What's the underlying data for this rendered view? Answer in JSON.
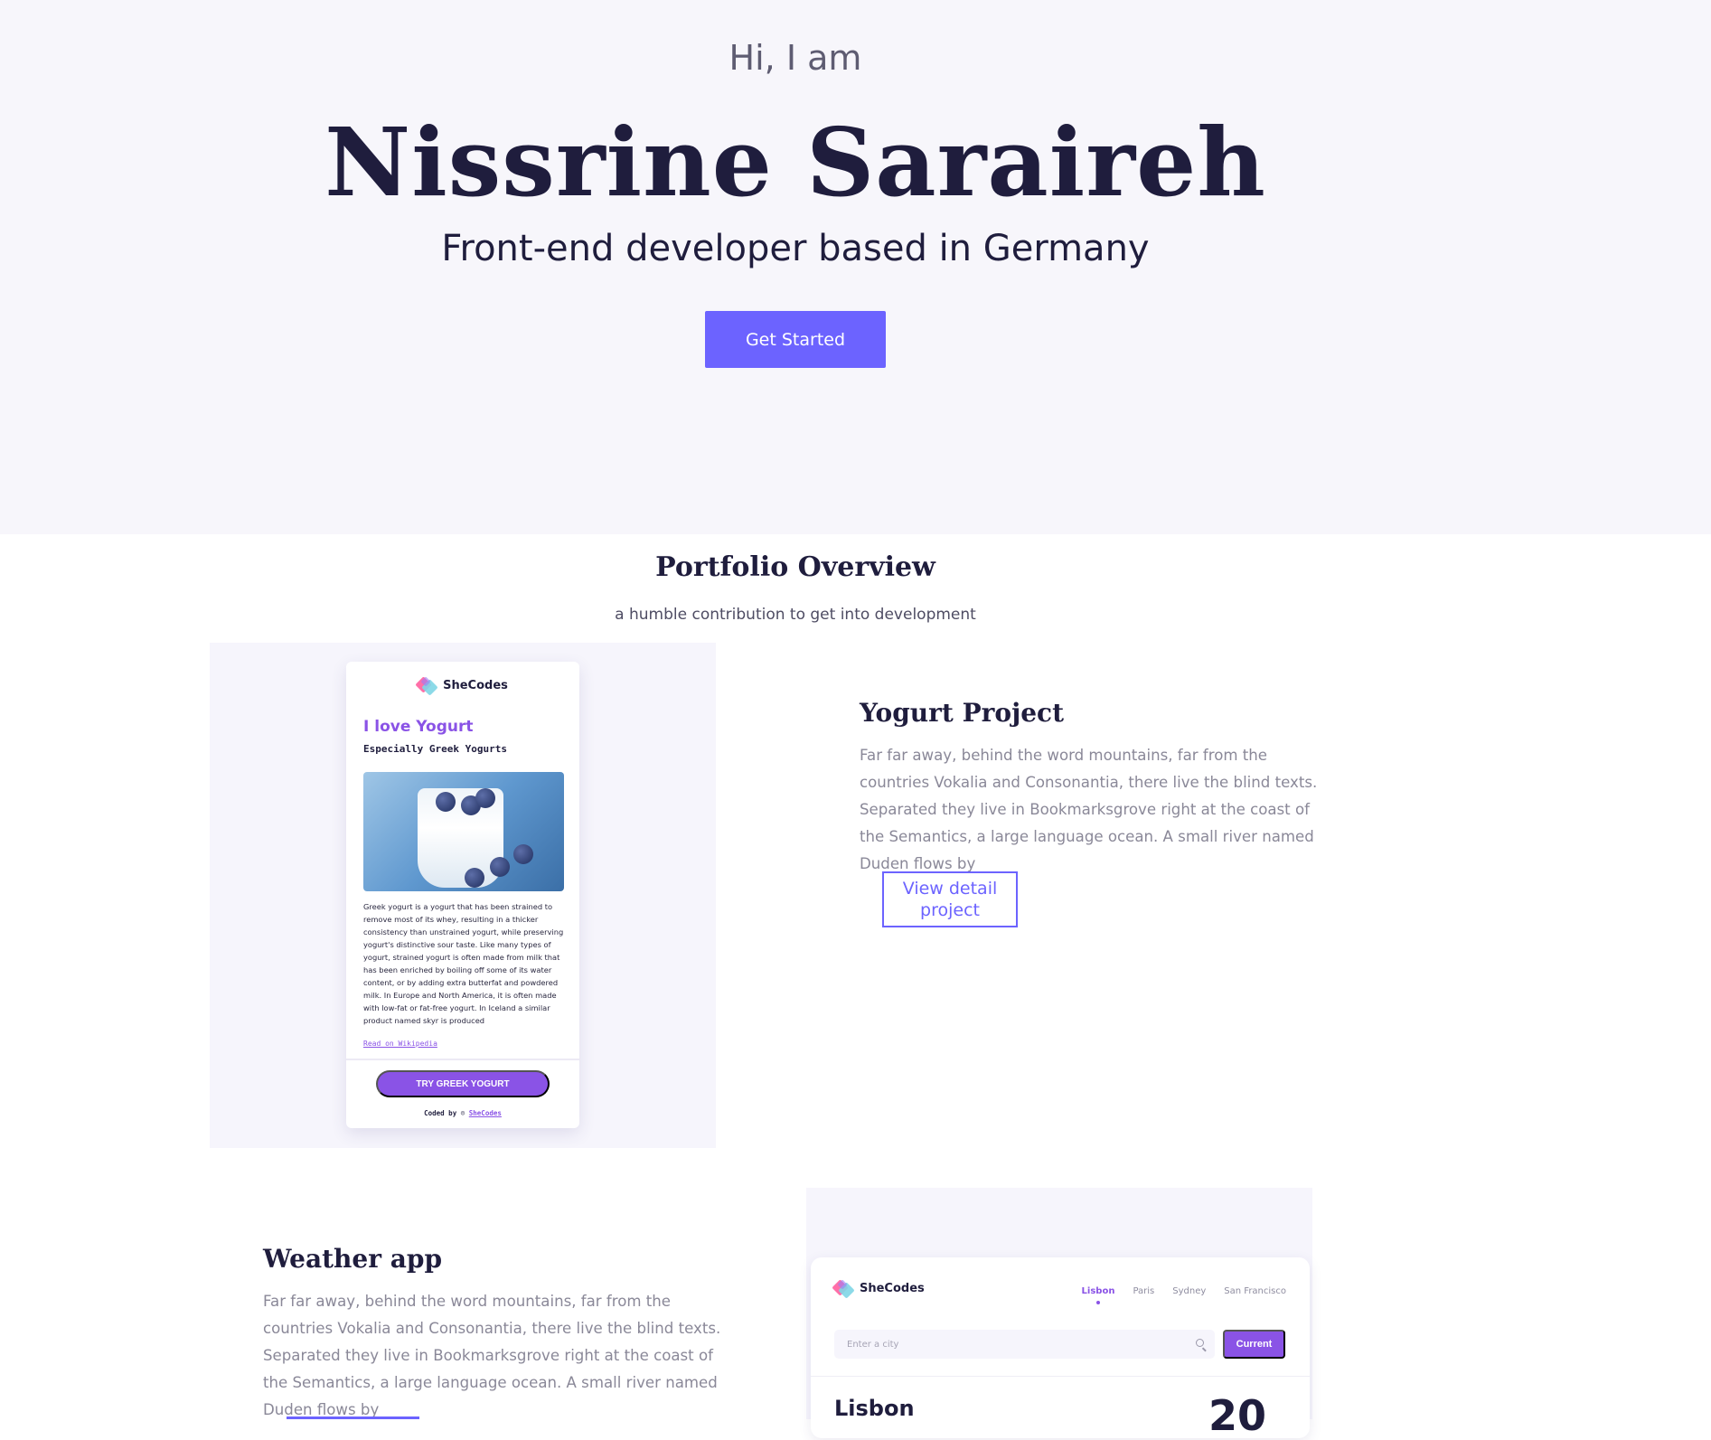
{
  "hero": {
    "greeting": "Hi, I am",
    "name": "Nissrine Saraireh",
    "role": "Front-end developer based in Germany",
    "cta": "Get Started"
  },
  "portfolio": {
    "title": "Portfolio Overview",
    "subtitle": "a humble contribution to get into development"
  },
  "projects": [
    {
      "title": "Yogurt Project",
      "description": "Far far away, behind the word mountains, far from the countries Vokalia and Consonantia, there live the blind texts. Separated they live in Bookmarksgrove right at the coast of the Semantics, a large language ocean. A small river named Duden flows by",
      "button": "View detail project"
    },
    {
      "title": "Weather app",
      "description": "Far far away, behind the word mountains, far from the countries Vokalia and Consonantia, there live the blind texts. Separated they live in Bookmarksgrove right at the coast of the Semantics, a large language ocean. A small river named Duden flows by"
    }
  ],
  "yogurt_preview": {
    "brand": "SheCodes",
    "heading": "I love Yogurt",
    "subheading": "Especially Greek Yogurts",
    "body": "Greek yogurt is a yogurt that has been strained to remove most of its whey, resulting in a thicker consistency than unstrained yogurt, while preserving yogurt's distinctive sour taste. Like many types of yogurt, strained yogurt is often made from milk that has been enriched by boiling off some of its water content, or by adding extra butterfat and powdered milk. In Europe and North America, it is often made with low-fat or fat-free yogurt. In Iceland a similar product named skyr is produced",
    "link": "Read on Wikipedia",
    "button": "TRY GREEK YOGURT",
    "footer_prefix": "Coded by",
    "footer_link": "SheCodes"
  },
  "weather_preview": {
    "brand": "SheCodes",
    "tabs": [
      "Lisbon",
      "Paris",
      "Sydney",
      "San Francisco"
    ],
    "search_placeholder": "Enter a city",
    "current_button": "Current",
    "city": "Lisbon",
    "temperature": "20"
  },
  "colors": {
    "accent": "#6c63ff",
    "brand_purple": "#8a53e6",
    "hero_bg": "#f7f6fb",
    "heading": "#1f1d3d"
  }
}
